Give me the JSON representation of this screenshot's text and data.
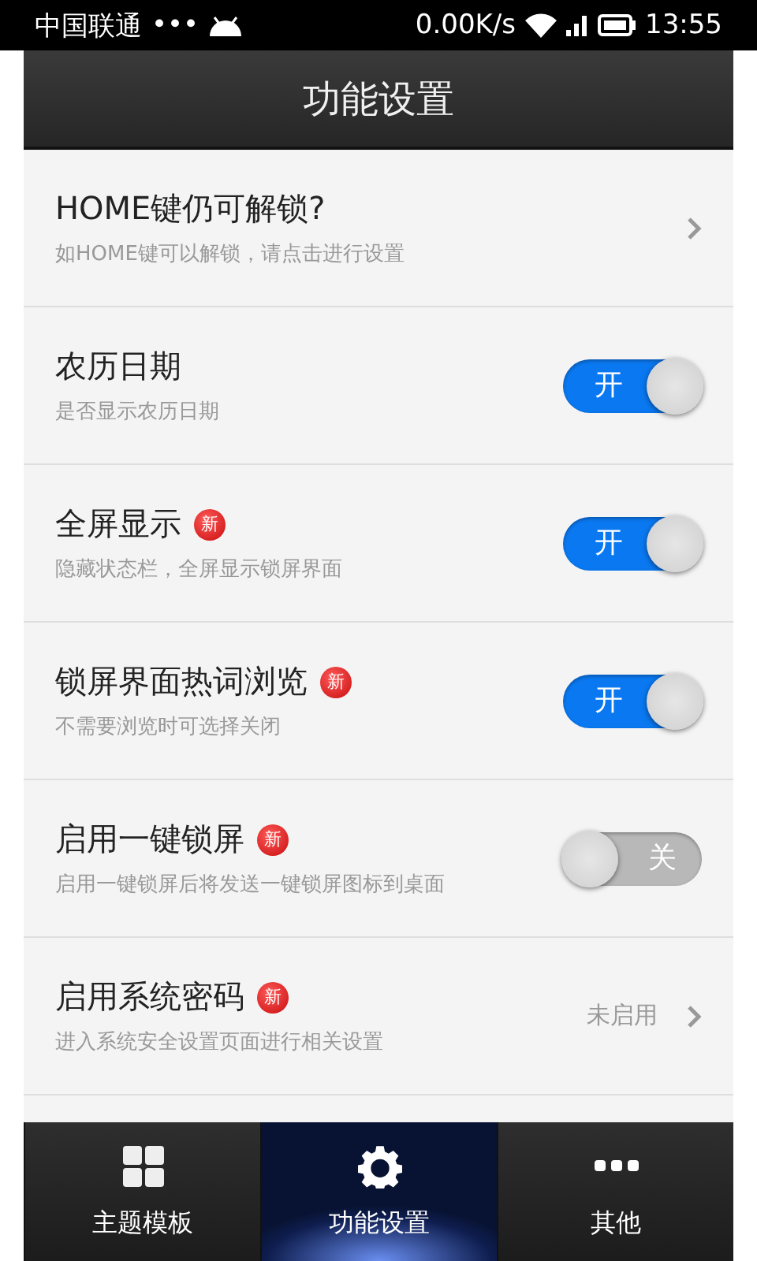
{
  "status_bar": {
    "carrier": "中国联通",
    "dots": "•••",
    "speed": "0.00K/s",
    "time": "13:55"
  },
  "header": {
    "title": "功能设置"
  },
  "settings": [
    {
      "kind": "link",
      "title": "HOME键仍可解锁?",
      "subtitle": "如HOME键可以解锁，请点击进行设置"
    },
    {
      "kind": "toggle",
      "title": "农历日期",
      "subtitle": "是否显示农历日期",
      "on": true,
      "toggle_label": "开"
    },
    {
      "kind": "toggle",
      "title": "全屏显示",
      "badge": "新",
      "subtitle": "隐藏状态栏，全屏显示锁屏界面",
      "on": true,
      "toggle_label": "开"
    },
    {
      "kind": "toggle",
      "title": "锁屏界面热词浏览",
      "badge": "新",
      "subtitle": "不需要浏览时可选择关闭",
      "on": true,
      "toggle_label": "开"
    },
    {
      "kind": "toggle",
      "title": "启用一键锁屏",
      "badge": "新",
      "subtitle": "启用一键锁屏后将发送一键锁屏图标到桌面",
      "on": false,
      "toggle_label": "关"
    },
    {
      "kind": "link",
      "title": "启用系统密码",
      "badge": "新",
      "subtitle": "进入系统安全设置页面进行相关设置",
      "value": "未启用"
    }
  ],
  "tabs": [
    {
      "kind": "grid",
      "label": "主题模板",
      "selected": false
    },
    {
      "kind": "gear",
      "label": "功能设置",
      "selected": true
    },
    {
      "kind": "more",
      "label": "其他",
      "selected": false
    }
  ]
}
